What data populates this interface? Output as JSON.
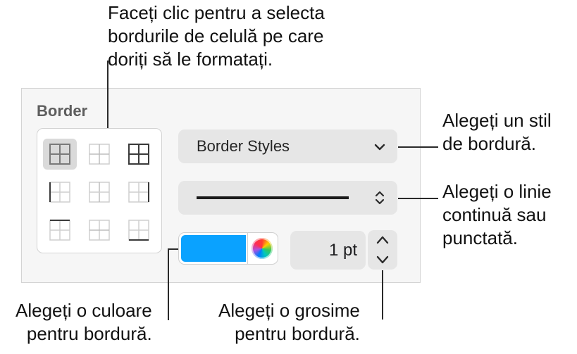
{
  "callouts": {
    "select_borders": [
      "Faceți clic pentru a selecta",
      "bordurile de celulă pe care",
      "doriți să le formatați."
    ],
    "border_style": [
      "Alegeți un stil",
      "de bordură."
    ],
    "line_type": [
      "Alegeți o linie",
      "continuă sau",
      "punctată."
    ],
    "color": [
      "Alegeți o culoare",
      "pentru bordură."
    ],
    "thickness": [
      "Alegeți o grosime",
      "pentru bordură."
    ]
  },
  "panel": {
    "section_title": "Border",
    "border_grid": {
      "selected_index": 0,
      "buttons": [
        {
          "name": "all-borders",
          "icon": "border-all-icon"
        },
        {
          "name": "inside-borders",
          "icon": "border-inside-icon"
        },
        {
          "name": "outside-borders",
          "icon": "border-outside-icon"
        },
        {
          "name": "left-border",
          "icon": "border-left-icon"
        },
        {
          "name": "vertical-inside-border",
          "icon": "border-vertical-inside-icon"
        },
        {
          "name": "right-border",
          "icon": "border-right-icon"
        },
        {
          "name": "top-border",
          "icon": "border-top-icon"
        },
        {
          "name": "horizontal-inside-border",
          "icon": "border-horizontal-inside-icon"
        },
        {
          "name": "bottom-border",
          "icon": "border-bottom-icon"
        }
      ]
    },
    "border_styles_popup": {
      "label": "Border Styles",
      "icon": "chevron-down-icon"
    },
    "line_style_popup": {
      "value": "solid",
      "icon": "up-down-chevron-icon"
    },
    "color_well": {
      "color": "#0aa2ff",
      "icon": "color-wheel-icon"
    },
    "width_field": {
      "value": "1 pt"
    }
  }
}
